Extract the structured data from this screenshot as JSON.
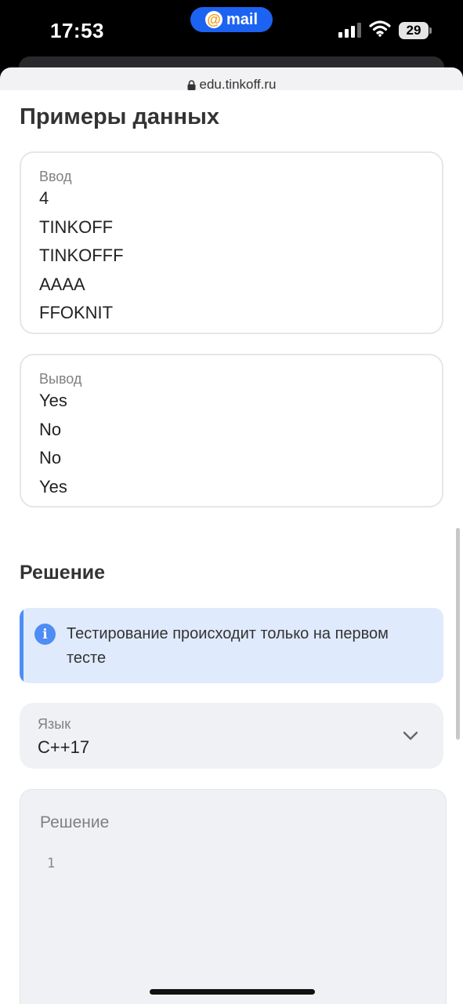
{
  "status_bar": {
    "time": "17:53",
    "app_pill": "mail",
    "battery": "29"
  },
  "browser": {
    "url": "edu.tinkoff.ru"
  },
  "examples": {
    "title": "Примеры данных",
    "input": {
      "label": "Ввод",
      "lines": [
        "4",
        "TINKOFF",
        "TINKOFFF",
        "AAAA",
        "FFOKNIT"
      ]
    },
    "output": {
      "label": "Вывод",
      "lines": [
        "Yes",
        "No",
        "No",
        "Yes"
      ]
    }
  },
  "solution": {
    "title": "Решение",
    "info": "Тестирование происходит только на первом тесте",
    "language": {
      "label": "Язык",
      "value": "C++17"
    },
    "editor": {
      "label": "Решение",
      "line_number": "1"
    }
  },
  "colors": {
    "accent_blue": "#1c63f2",
    "info_bg": "#dfeafd",
    "info_accent": "#4d8df5"
  }
}
